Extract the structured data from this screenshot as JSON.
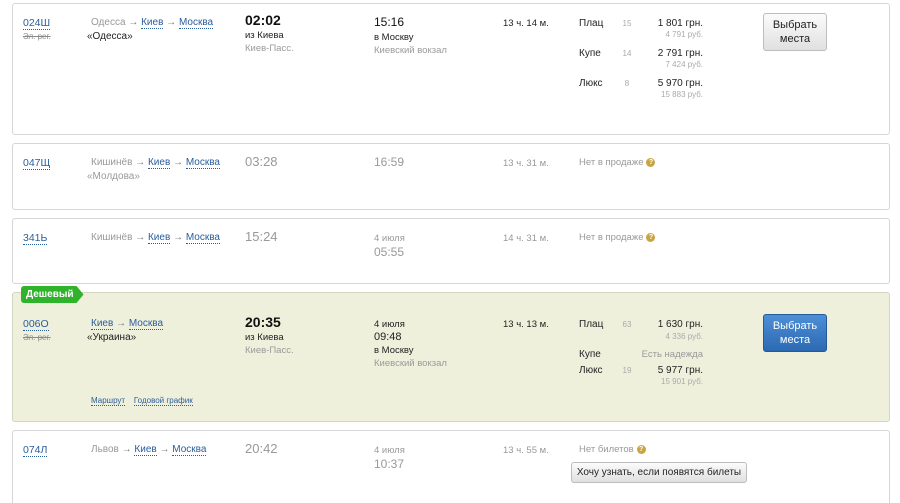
{
  "trains": [
    {
      "number": "024Ш",
      "el_reg": "Эл. рег.",
      "route_from": "Одесса",
      "route_via": "Киев",
      "route_to": "Москва",
      "name": "«Одесса»",
      "dep_time": "02:02",
      "dep_from": "из Киева",
      "dep_station": "Киев-Пасс.",
      "arr_time": "15:16",
      "arr_to": "в Москву",
      "arr_station": "Киевский вокзал",
      "duration": "13 ч. 14 м.",
      "classes": [
        {
          "name": "Плац",
          "count": "15",
          "price": "1 801 грн.",
          "rub": "4 791 руб."
        },
        {
          "name": "Купе",
          "count": "14",
          "price": "2 791 грн.",
          "rub": "7 424 руб."
        },
        {
          "name": "Люкс",
          "count": "8",
          "price": "5 970 грн.",
          "rub": "15 883 руб."
        }
      ],
      "button": "Выбрать места"
    },
    {
      "number": "047Щ",
      "route_from": "Кишинёв",
      "route_via": "Киев",
      "route_to": "Москва",
      "name": "«Молдова»",
      "dep_time": "03:28",
      "arr_time": "16:59",
      "duration": "13 ч. 31 м.",
      "status": "Нет в продаже"
    },
    {
      "number": "341Ь",
      "route_from": "Кишинёв",
      "route_via": "Киев",
      "route_to": "Москва",
      "dep_time": "15:24",
      "arr_date": "4 июля",
      "arr_time": "05:55",
      "duration": "14 ч. 31 м.",
      "status": "Нет в продаже"
    },
    {
      "badge": "Дешевый",
      "number": "006О",
      "el_reg": "Эл. рег.",
      "route_from": "Киев",
      "route_to": "Москва",
      "name": "«Украина»",
      "dep_time": "20:35",
      "dep_from": "из Киева",
      "dep_station": "Киев-Пасс.",
      "arr_date": "4 июля",
      "arr_time": "09:48",
      "arr_to": "в Москву",
      "arr_station": "Киевский вокзал",
      "duration": "13 ч. 13 м.",
      "classes": [
        {
          "name": "Плац",
          "count": "63",
          "price": "1 630 грн.",
          "rub": "4 336 руб."
        },
        {
          "name": "Купе",
          "hope": "Есть надежда"
        },
        {
          "name": "Люкс",
          "count": "19",
          "price": "5 977 грн.",
          "rub": "15 901 руб."
        }
      ],
      "button": "Выбрать места",
      "link_route": "Маршрут",
      "link_schedule": "Годовой график"
    },
    {
      "number": "074Л",
      "route_from": "Львов",
      "route_via": "Киев",
      "route_to": "Москва",
      "dep_time": "20:42",
      "arr_date": "4 июля",
      "arr_time": "10:37",
      "duration": "13 ч. 55 м.",
      "status": "Нет билетов",
      "notify_button": "Хочу узнать, если появятся билеты"
    }
  ],
  "arrow": "→",
  "colors": {
    "link": "#2a5d9c",
    "cheap_bg": "#eff0dc",
    "badge": "#2fb32a",
    "primary_button": "#2c69b3"
  }
}
